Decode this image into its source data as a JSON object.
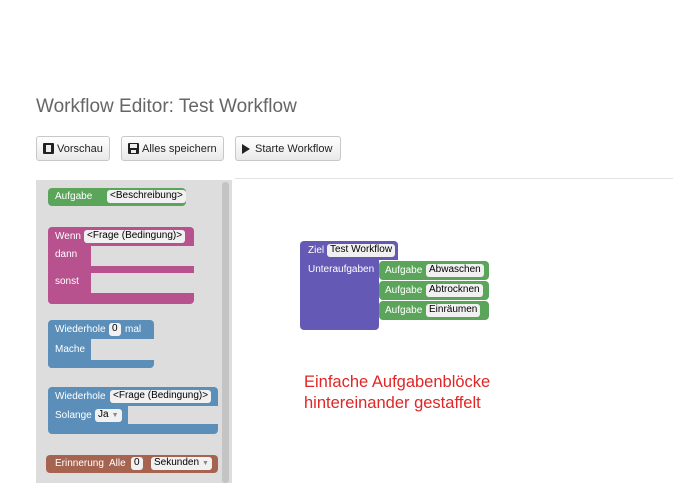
{
  "page": {
    "title": "Workflow Editor: Test Workflow"
  },
  "toolbar": {
    "preview_label": "Vorschau",
    "save_label": "Alles speichern",
    "start_label": "Starte Workflow"
  },
  "toolbox": {
    "task_block": {
      "label": "Aufgabe",
      "field": "<Beschreibung>"
    },
    "if_block": {
      "label": "Wenn",
      "field": "<Frage (Bedingung)>",
      "then": "dann",
      "else": "sonst"
    },
    "repeat_block": {
      "label": "Wiederhole",
      "count": "0",
      "suffix": "mal",
      "do": "Mache"
    },
    "while_block": {
      "label": "Wiederhole",
      "field": "<Frage (Bedingung)>",
      "while": "Solange",
      "option": "Ja"
    },
    "reminder_block": {
      "label": "Erinnerung",
      "scope": "Alle",
      "count": "0",
      "unit": "Sekunden"
    }
  },
  "workspace": {
    "goal_block": {
      "label": "Ziel",
      "name": "Test Workflow",
      "subtasks_label": "Unteraufgaben",
      "tasks": [
        {
          "label": "Aufgabe",
          "value": "Abwaschen"
        },
        {
          "label": "Aufgabe",
          "value": "Abtrocknen"
        },
        {
          "label": "Aufgabe",
          "value": "Einräumen"
        }
      ]
    }
  },
  "annotation": {
    "line1": "Einfache Aufgabenblöcke",
    "line2": "hintereinander gestaffelt",
    "color": "#e02626"
  },
  "colors": {
    "task": "#5ba55b",
    "if": "#b7528f",
    "loop": "#5b8fba",
    "reminder": "#a56350",
    "goal": "#645ab5"
  }
}
